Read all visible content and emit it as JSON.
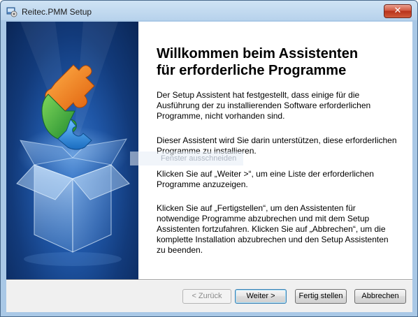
{
  "window": {
    "title": "Reitec.PMM Setup",
    "close_label": "✕"
  },
  "overlay": {
    "ghost_text": "Fenster ausschneiden"
  },
  "content": {
    "heading_line1": "Willkommen beim Assistenten",
    "heading_line2": "für erforderliche Programme",
    "paragraph1": "Der Setup Assistent hat festgestellt, dass einige für die Ausführung der zu installierenden Software erforderlichen Programme, nicht vorhanden sind.",
    "paragraph2": "Dieser Assistent wird Sie darin unterstützen, diese erforderlichen Programme zu installieren.",
    "paragraph3": "Klicken Sie auf „Weiter >“, um eine Liste der erforderlichen Programme anzuzeigen.",
    "paragraph4": "Klicken Sie auf „Fertigstellen“, um den Assistenten für notwendige Programme abzubrechen und mit dem Setup Assistenten fortzufahren. Klicken Sie auf „Abbrechen“, um die komplette Installation abzubrechen und den Setup Assistenten zu beenden."
  },
  "buttons": {
    "back": "< Zurück",
    "next": "Weiter >",
    "finish": "Fertig stellen",
    "cancel": "Abbrechen"
  },
  "icons": {
    "app": "setup-icon",
    "banner": "puzzle-box-illustration"
  },
  "colors": {
    "puzzle_orange": "#f07a1a",
    "puzzle_green": "#3aa845",
    "puzzle_blue": "#2a8ad8",
    "banner_blue": "#1f56a6",
    "close_red": "#c84a30"
  }
}
